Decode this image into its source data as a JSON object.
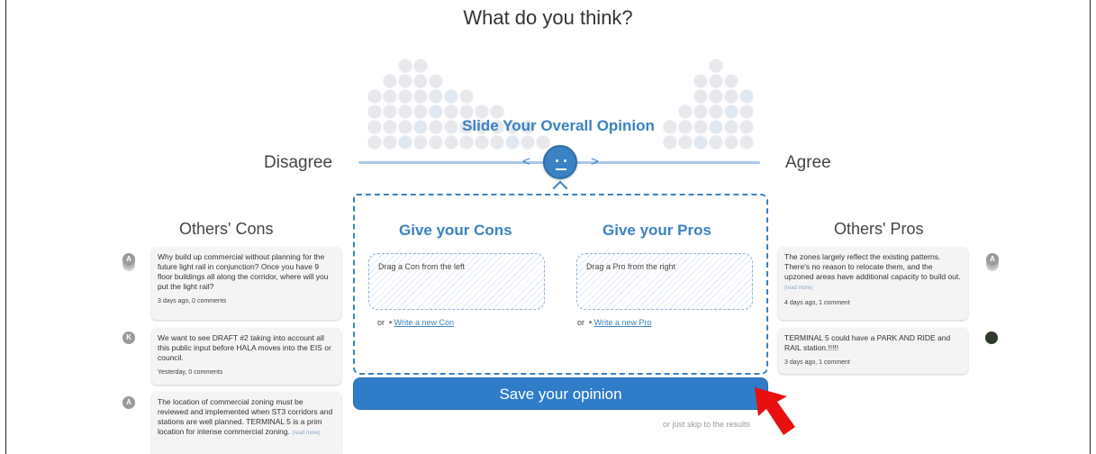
{
  "headline": "What do you think?",
  "slider": {
    "title": "Slide Your Overall Opinion",
    "left_label": "Disagree",
    "right_label": "Agree",
    "arrow_left": "<",
    "arrow_right": ">"
  },
  "cons": {
    "title": "Give your Cons",
    "drop_text": "Drag a Con from the left",
    "or_label": "or",
    "write_link": "Write a new Con"
  },
  "pros": {
    "title": "Give your Pros",
    "drop_text": "Drag a Pro from the right",
    "or_label": "or",
    "write_link": "Write a new Pro"
  },
  "save_button": "Save your opinion",
  "skip_text": "or just skip to the results",
  "others_cons": {
    "title": "Others' Cons",
    "items": [
      {
        "avatar": "A",
        "text": "Why build up commercial without planning for the future light rail in conjunction? Once you have 9 floor buildings all along the corridor, where will you put the light rail?",
        "read_more": "",
        "meta": "3 days ago, 0 comments"
      },
      {
        "avatar": "K",
        "text": "We want to see DRAFT #2 taking into account all this public input before HALA moves into the EIS or council.",
        "read_more": "",
        "meta": "Yesterday, 0 comments"
      },
      {
        "avatar": "A",
        "text": "The location of commercial zoning must be reviewed and implemented when ST3 corridors and stations are well planned. TERMINAL 5 is a prim location for intense commercial zoning.",
        "read_more": "(read more)",
        "meta": ""
      }
    ]
  },
  "others_pros": {
    "title": "Others' Pros",
    "items": [
      {
        "avatar": "A",
        "text": "The zones largely reflect the existing patterns. There's no reason to relocate them, and the upzoned areas have additional capacity to build out.",
        "read_more": "(read more)",
        "meta": "4 days ago, 1 comment"
      },
      {
        "avatar": "",
        "text": "TERMINAL 5 could have a PARK AND RIDE and RAIL station.!!!!!",
        "read_more": "",
        "meta": "3 days ago, 1 comment"
      }
    ]
  },
  "colors": {
    "accent": "#3b82c4",
    "button": "#2f7cc8",
    "cursor_arrow": "#e8100e"
  }
}
